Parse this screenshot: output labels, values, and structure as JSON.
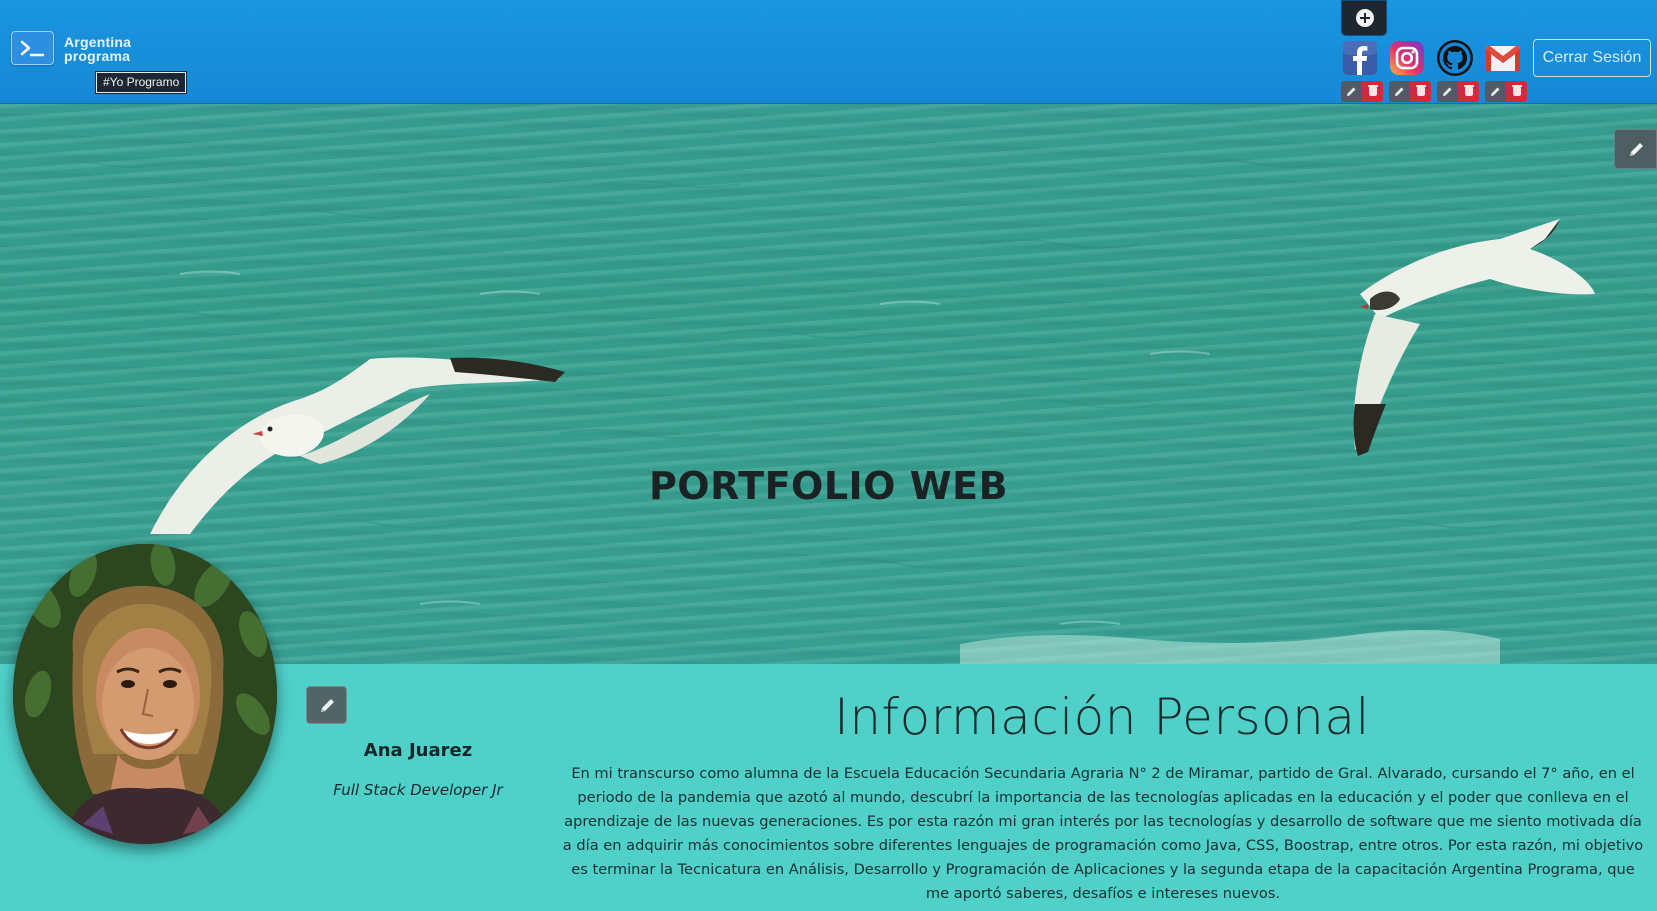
{
  "header": {
    "logo_line1": "Argentina",
    "logo_line2": "programa",
    "logo_tag": "#Yo Programo",
    "add_button_icon": "plus-circle-icon",
    "social_links": [
      {
        "name": "facebook",
        "icon": "facebook-icon"
      },
      {
        "name": "instagram",
        "icon": "instagram-icon"
      },
      {
        "name": "github",
        "icon": "github-icon"
      },
      {
        "name": "gmail",
        "icon": "gmail-icon"
      }
    ],
    "logout_label": "Cerrar Sesión"
  },
  "banner": {
    "title": "PORTFOLIO WEB"
  },
  "profile": {
    "name": "Ana Juarez",
    "role": "Full Stack Developer Jr"
  },
  "about": {
    "title": "Información Personal",
    "body": "En mi transcurso como alumna de la Escuela Educación Secundaria Agraria N° 2 de Miramar, partido de Gral. Alvarado, cursando el 7° año, en el periodo de la pandemia que azotó al mundo, descubrí la importancia de las tecnologías aplicadas en la educación y el poder que conlleva en el aprendizaje de las nuevas generaciones. Es por esta razón mi gran interés por las tecnologías y desarrollo de software que me siento motivada día a día en adquirir más conocimientos sobre diferentes lenguajes de programación como Java, CSS, Boostrap, entre otros. Por esta razón, mi objetivo es terminar la Tecnicatura en Análisis, Desarrollo y Programación de Aplicaciones y la segunda etapa de la capacitación Argentina Programa, que me aportó saberes, desafíos e intereses nuevos."
  },
  "colors": {
    "header_blue": "#1a95de",
    "section_teal": "#4fd0c9",
    "delete_red": "#d6283c",
    "edit_gray": "#4f5b66"
  }
}
